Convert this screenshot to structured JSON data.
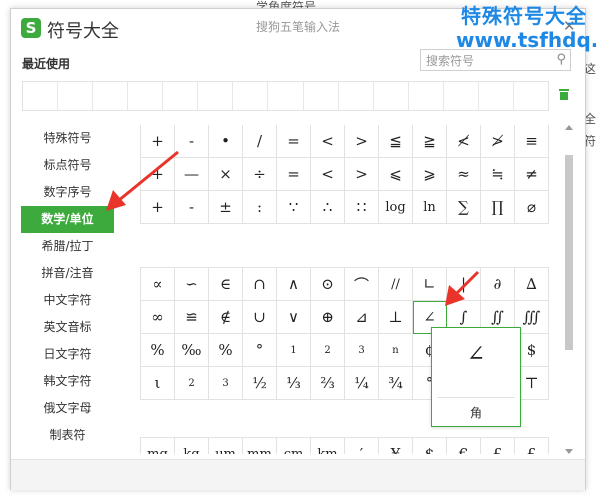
{
  "background": {
    "text_top": "学角度符号",
    "text_right_1": "这",
    "text_right_2": "全",
    "text_right_3": "符"
  },
  "watermark": {
    "line1": "特殊符号大全",
    "line2": "www.tsfhdq.cn"
  },
  "window": {
    "logo": "S",
    "title": "符号大全",
    "subtitle": "搜狗五笔输入法",
    "close": "✕"
  },
  "recent": {
    "label": "最近使用",
    "cells": 15
  },
  "search": {
    "placeholder": "搜索符号",
    "icon": "search-icon"
  },
  "sidebar": {
    "items": [
      {
        "label": "特殊符号",
        "active": false
      },
      {
        "label": "标点符号",
        "active": false
      },
      {
        "label": "数字序号",
        "active": false
      },
      {
        "label": "数学/单位",
        "active": true
      },
      {
        "label": "希腊/拉丁",
        "active": false
      },
      {
        "label": "拼音/注音",
        "active": false
      },
      {
        "label": "中文字符",
        "active": false
      },
      {
        "label": "英文音标",
        "active": false
      },
      {
        "label": "日文字符",
        "active": false
      },
      {
        "label": "韩文字符",
        "active": false
      },
      {
        "label": "俄文字母",
        "active": false
      },
      {
        "label": "制表符",
        "active": false
      }
    ]
  },
  "grid1": [
    "+",
    "-",
    "•",
    "/",
    "=",
    "<",
    ">",
    "≦",
    "≧",
    "≮",
    "≯",
    "≡",
    "+",
    "—",
    "×",
    "÷",
    "=",
    "<",
    ">",
    "⩽",
    "⩾",
    "≈",
    "≒",
    "≠",
    "+",
    "-",
    "±",
    ":",
    "∵",
    "∴",
    "∷",
    "log",
    "ln",
    "∑",
    "∏",
    "⌀"
  ],
  "grid2": [
    "∝",
    "∽",
    "∈",
    "∩",
    "∧",
    "⊙",
    "⌒",
    "//",
    "∟",
    "|",
    "∂",
    "∆",
    "∞",
    "≌",
    "∉",
    "∪",
    "∨",
    "⊕",
    "⊿",
    "⊥",
    "∠",
    "∫",
    "∬",
    "∭",
    "%",
    "‰",
    "%",
    "°",
    "1",
    "2",
    "3",
    "n",
    "¢",
    "",
    "",
    "$",
    "ι",
    "2",
    "3",
    "½",
    "⅓",
    "⅔",
    "¼",
    "¾",
    "°",
    "",
    "",
    "⊤"
  ],
  "grid3": [
    "mg",
    "kg",
    "μm",
    "mm",
    "cm",
    "km",
    "′",
    "¥",
    "$",
    "€",
    "£",
    "£"
  ],
  "preview": {
    "glyph": "∠",
    "name": "角"
  },
  "colors": {
    "accent": "#3caa3c",
    "watermark": "#1e88e5",
    "arrow": "#e8342b"
  }
}
